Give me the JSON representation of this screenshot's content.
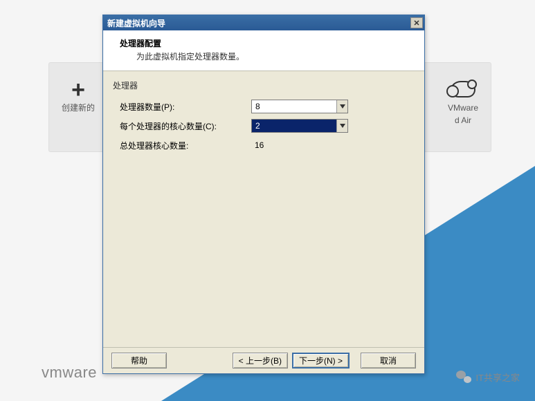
{
  "background": {
    "create_new_label": "创建新的",
    "vmware_label": "VMware",
    "air_label": "d Air",
    "vmware_logo": "vmware",
    "wechat_label": "IT共享之家"
  },
  "dialog": {
    "title": "新建虚拟机向导",
    "close_glyph": "✕",
    "header": {
      "title": "处理器配置",
      "description": "为此虚拟机指定处理器数量。"
    },
    "processors": {
      "group_label": "处理器",
      "count_label": "处理器数量(P):",
      "count_value": "8",
      "cores_label": "每个处理器的核心数量(C):",
      "cores_value": "2",
      "total_label": "总处理器核心数量:",
      "total_value": "16"
    },
    "buttons": {
      "help": "帮助",
      "back": "< 上一步(B)",
      "next": "下一步(N) >",
      "cancel": "取消"
    }
  }
}
